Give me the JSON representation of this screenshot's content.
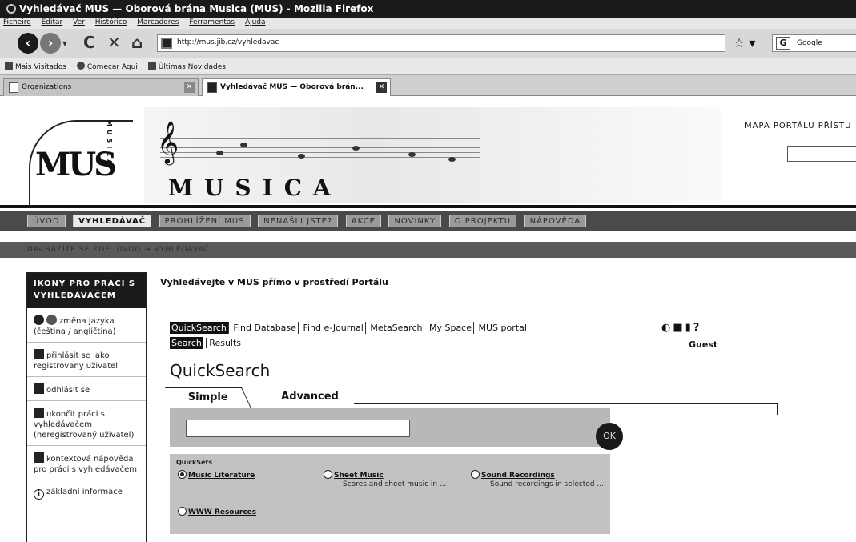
{
  "browser": {
    "window_title": "Vyhledávač MUS — Oborová brána Musica (MUS) - Mozilla Firefox",
    "menu": [
      "Ficheiro",
      "Editar",
      "Ver",
      "Histórico",
      "Marcadores",
      "Ferramentas",
      "Ajuda"
    ],
    "url": "http://mus.jib.cz/vyhledavac",
    "search_engine_placeholder": "Google",
    "bookmarks": [
      "Mais Visitados",
      "Começar Aqui",
      "Últimas Novidades"
    ],
    "tabs": [
      {
        "label": "Organizations"
      },
      {
        "label": "Vyhledávač MUS — Oborová brán..."
      }
    ]
  },
  "header": {
    "logo_text": "MUS",
    "logo_side_text": "MUSICA",
    "brand": "MUSICA",
    "top_links": "MAPA PORTÁLU   PŘÍSTU"
  },
  "main_nav": [
    "ÚVOD",
    "VYHLEDÁVAČ",
    "PROHLÍŽENÍ MUS",
    "NENAŠLI JSTE?",
    "AKCE",
    "NOVINKY",
    "O PROJEKTU",
    "NÁPOVĚDA"
  ],
  "breadcrumb": "NACHÁZÍTE SE ZDE: ÚVOD → VYHLEDÁVAČ",
  "sidebar": {
    "heading": "IKONY PRO PRÁCI S VYHLEDÁVAČEM",
    "items": [
      {
        "icon": "language-icon",
        "text": "změna jazyka (čeština / angličtina)"
      },
      {
        "icon": "lock-icon",
        "text": "přihlásit se jako registrovaný uživatel"
      },
      {
        "icon": "logout-icon",
        "text": "odhlásit se"
      },
      {
        "icon": "exit-icon",
        "text": "ukončit práci s vyhledávačem (neregistrovaný uživatel)"
      },
      {
        "icon": "help-icon",
        "text": "kontextová nápověda pro práci s vyhledávačem"
      },
      {
        "icon": "info-icon",
        "text": "základní informace"
      }
    ]
  },
  "content": {
    "title": "Vyhledávejte v MUS přímo v prostředí Portálu",
    "metalib_tabs": [
      "QuickSearch",
      "Find Database",
      "Find e-Journal",
      "MetaSearch",
      "My Space",
      "MUS portal"
    ],
    "metalib_subtabs": [
      "Search",
      "Results"
    ],
    "user_icons": "◐🔒▮?",
    "user_status": "Guest",
    "quicksearch_title": "QuickSearch",
    "search_modes": [
      "Simple",
      "Advanced"
    ],
    "search_input_value": "",
    "ok_label": "OK",
    "quicksets_label": "QuickSets",
    "quicksets": [
      {
        "name": "Music Literature",
        "desc": "",
        "selected": true
      },
      {
        "name": "Sheet Music",
        "desc": "Scores and sheet music in ...",
        "selected": false
      },
      {
        "name": "Sound Recordings",
        "desc": "Sound recordings in selected ...",
        "selected": false
      },
      {
        "name": "WWW Resources",
        "desc": "",
        "selected": false
      }
    ]
  }
}
